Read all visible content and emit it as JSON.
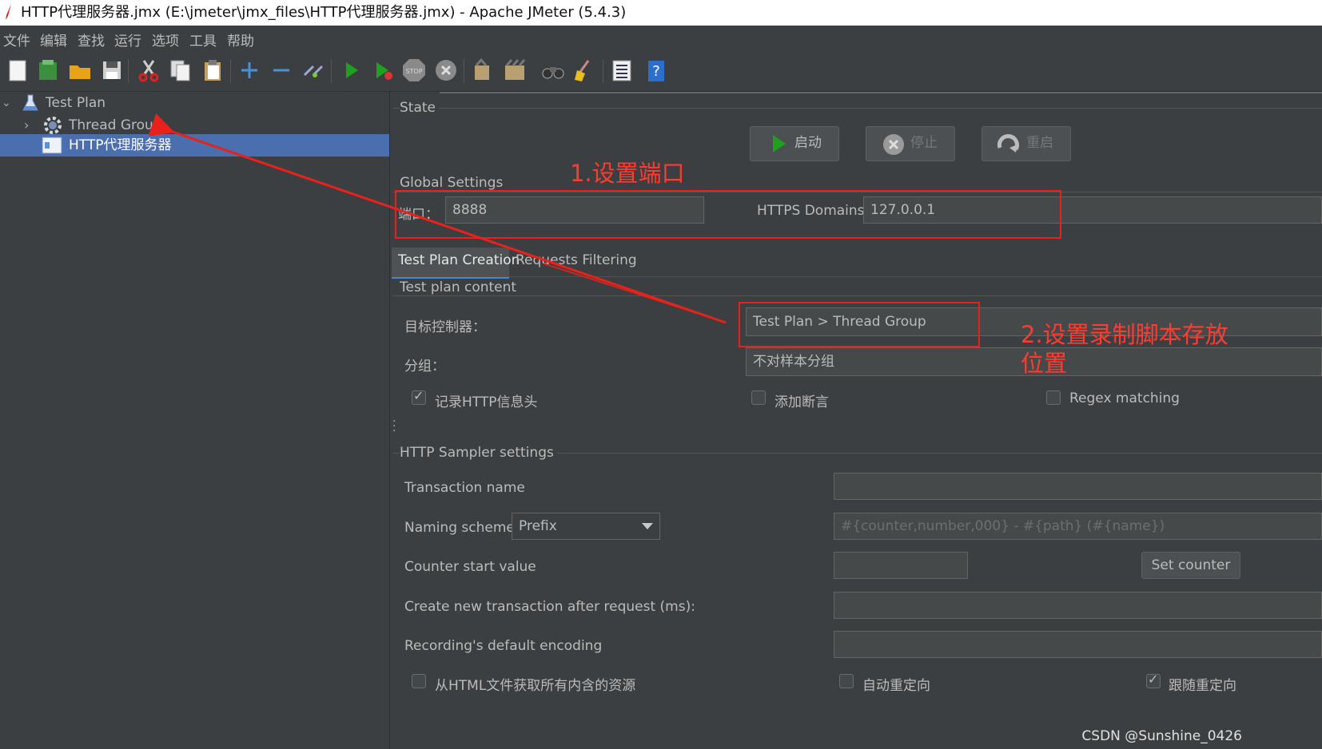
{
  "window": {
    "title": "HTTP代理服务器.jmx (E:\\jmeter\\jmx_files\\HTTP代理服务器.jmx) - Apache JMeter (5.4.3)"
  },
  "menu": [
    "文件",
    "编辑",
    "查找",
    "运行",
    "选项",
    "工具",
    "帮助"
  ],
  "tree": {
    "items": [
      {
        "label": "Test Plan",
        "icon": "flask-icon"
      },
      {
        "label": "Thread Group",
        "icon": "gear-icon"
      },
      {
        "label": "HTTP代理服务器",
        "icon": "proxy-icon"
      }
    ]
  },
  "state": {
    "title": "State",
    "start": "启动",
    "stop": "停止",
    "restart": "重启"
  },
  "global": {
    "title": "Global Settings",
    "port_label": "端口：",
    "port_value": "8888",
    "https_label": "HTTPS Domains:",
    "https_value": "127.0.0.1"
  },
  "tabs": [
    "Test Plan Creation",
    "Requests Filtering"
  ],
  "content": {
    "title": "Test plan content",
    "target_label": "目标控制器：",
    "target_value": "Test Plan > Thread Group",
    "group_label": "分组：",
    "group_value": "不对样本分组",
    "cb_record_headers": "记录HTTP信息头",
    "cb_add_assertion": "添加断言",
    "cb_regex": "Regex matching"
  },
  "sampler": {
    "title": "HTTP Sampler settings",
    "transaction_label": "Transaction name",
    "naming_label": "Naming scheme",
    "naming_value": "Prefix",
    "naming_placeholder": "#{counter,number,000} - #{path} (#{name})",
    "counter_label": "Counter start value",
    "set_counter": "Set counter",
    "new_tx_label": "Create new transaction after request (ms):",
    "encoding_label": "Recording's default encoding",
    "cb_fetch_resources": "从HTML文件获取所有内含的资源",
    "cb_auto_redirect": "自动重定向",
    "cb_follow_redirect": "跟随重定向"
  },
  "annotations": {
    "step1": "1.设置端口",
    "step2_line1": "2.设置录制脚本存放",
    "step2_line2": "位置"
  },
  "watermark": "CSDN @Sunshine_0426",
  "colors": {
    "selection": "#4b6eaf",
    "annotation": "#e8211b",
    "background": "#3c3f41"
  }
}
